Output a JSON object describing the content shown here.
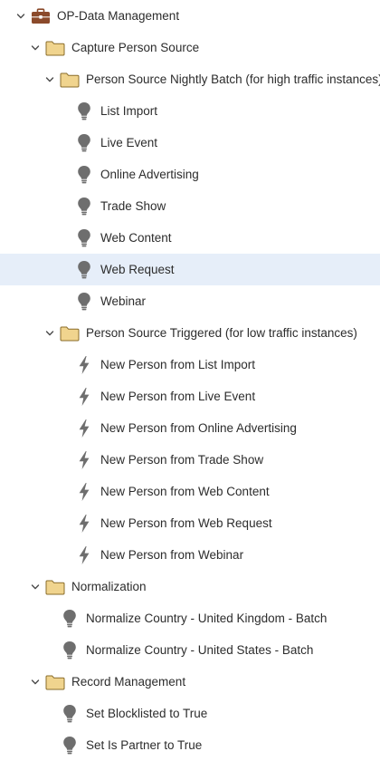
{
  "tree": {
    "rows": [
      {
        "label": "OP-Data Management",
        "icon": "briefcase-icon",
        "expanded": true,
        "level": 0
      },
      {
        "label": "Capture Person Source",
        "icon": "folder-icon",
        "expanded": true,
        "level": 1
      },
      {
        "label": "Person Source Nightly Batch (for high traffic instances)",
        "icon": "folder-icon",
        "expanded": true,
        "level": 2
      },
      {
        "label": "List Import",
        "icon": "lightbulb-icon",
        "level": 3
      },
      {
        "label": "Live Event",
        "icon": "lightbulb-icon",
        "level": 3
      },
      {
        "label": "Online Advertising",
        "icon": "lightbulb-icon",
        "level": 3
      },
      {
        "label": "Trade Show",
        "icon": "lightbulb-icon",
        "level": 3
      },
      {
        "label": "Web Content",
        "icon": "lightbulb-icon",
        "level": 3
      },
      {
        "label": "Web Request",
        "icon": "lightbulb-icon",
        "level": 3,
        "selected": true
      },
      {
        "label": "Webinar",
        "icon": "lightbulb-icon",
        "level": 3
      },
      {
        "label": "Person Source Triggered (for low traffic instances)",
        "icon": "folder-icon",
        "expanded": true,
        "level": 2
      },
      {
        "label": "New Person from List Import",
        "icon": "lightning-bolt-icon",
        "level": 3
      },
      {
        "label": "New Person from Live Event",
        "icon": "lightning-bolt-icon",
        "level": 3
      },
      {
        "label": "New Person from Online Advertising",
        "icon": "lightning-bolt-icon",
        "level": 3
      },
      {
        "label": "New Person from Trade Show",
        "icon": "lightning-bolt-icon",
        "level": 3
      },
      {
        "label": "New Person from Web Content",
        "icon": "lightning-bolt-icon",
        "level": 3
      },
      {
        "label": "New Person from Web Request",
        "icon": "lightning-bolt-icon",
        "level": 3
      },
      {
        "label": "New Person from Webinar",
        "icon": "lightning-bolt-icon",
        "level": 3
      },
      {
        "label": "Normalization",
        "icon": "folder-icon",
        "expanded": true,
        "level": 1
      },
      {
        "label": "Normalize Country - United Kingdom - Batch",
        "icon": "lightbulb-icon",
        "level": 2
      },
      {
        "label": "Normalize Country - United States - Batch",
        "icon": "lightbulb-icon",
        "level": 2
      },
      {
        "label": "Record Management",
        "icon": "folder-icon",
        "expanded": true,
        "level": 1
      },
      {
        "label": "Set Blocklisted to True",
        "icon": "lightbulb-icon",
        "level": 2
      },
      {
        "label": "Set Is Partner to True",
        "icon": "lightbulb-icon",
        "level": 2
      }
    ]
  },
  "colors": {
    "selected_row": "#e6eef9",
    "folder_fill": "#f0d48e",
    "folder_stroke": "#8a6d2b",
    "briefcase": "#8b4a2b",
    "program_icon": "#6e6e6e",
    "chevron": "#4b4b4b",
    "text": "#2c2c2c"
  }
}
